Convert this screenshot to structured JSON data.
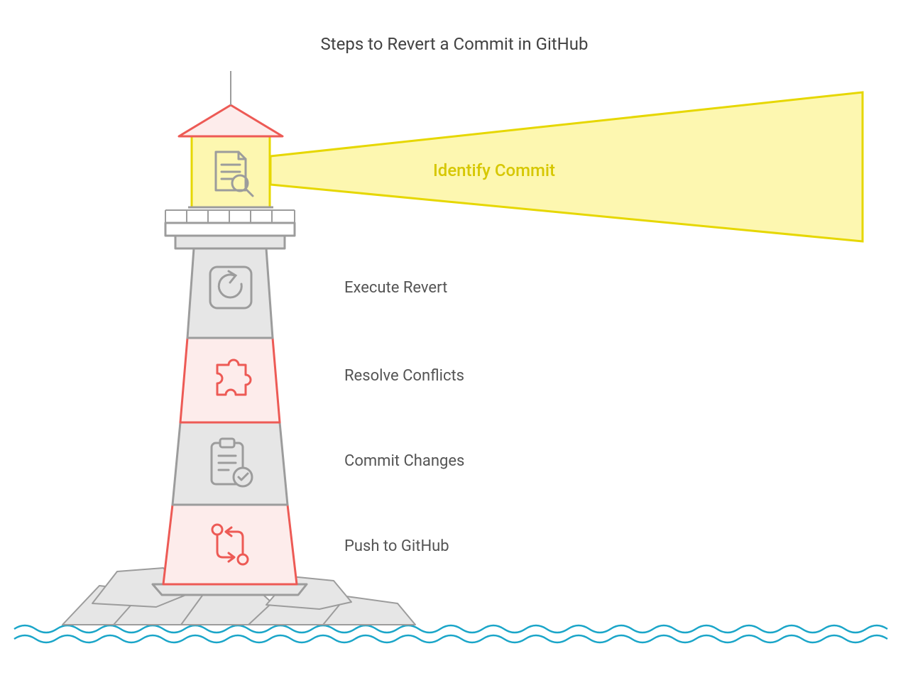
{
  "title": "Steps to Revert a Commit in GitHub",
  "steps": [
    {
      "label": "Identify Commit",
      "highlight": true,
      "icon": "document-search"
    },
    {
      "label": "Execute Revert",
      "highlight": false,
      "icon": "revert-arrow"
    },
    {
      "label": "Resolve Conflicts",
      "highlight": false,
      "icon": "puzzle-piece"
    },
    {
      "label": "Commit Changes",
      "highlight": false,
      "icon": "clipboard-check"
    },
    {
      "label": "Push to GitHub",
      "highlight": false,
      "icon": "sync-arrows"
    }
  ],
  "colors": {
    "red": "#ed5a55",
    "pink": "#fdeceb",
    "gray": "#9c9c9c",
    "lightgray": "#e6e6e6",
    "yellow_stroke": "#e6d700",
    "yellow_fill": "#fdf7b0",
    "water": "#1aa5c8",
    "text": "#424242"
  }
}
